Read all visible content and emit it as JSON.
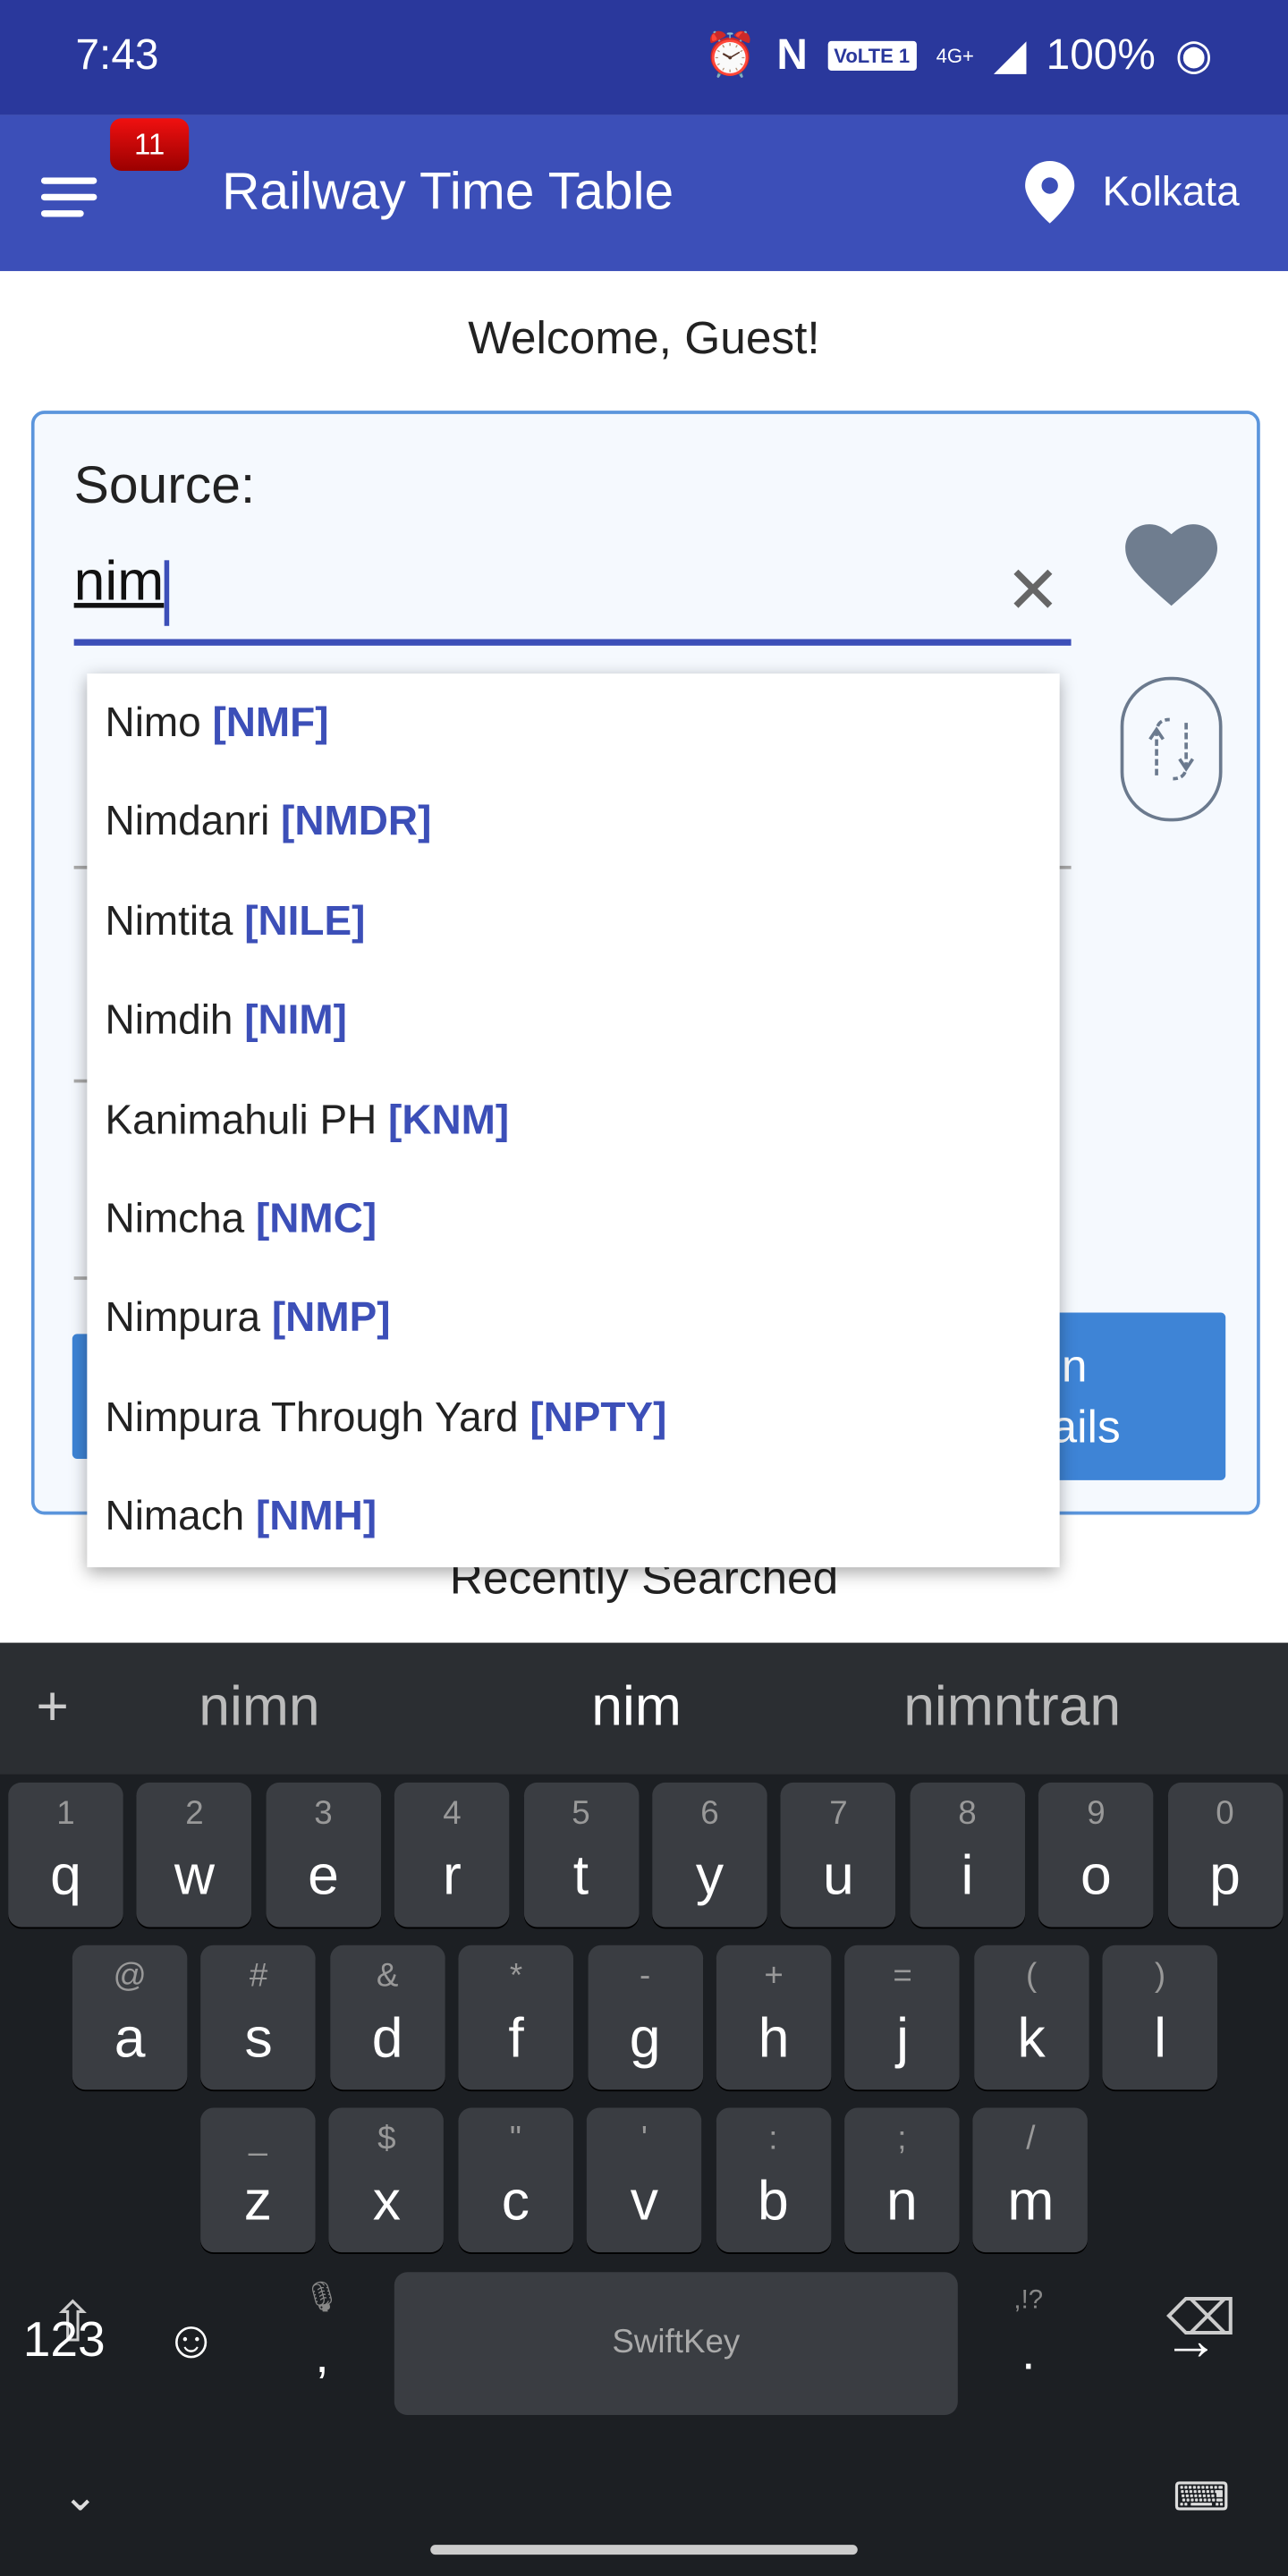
{
  "status_bar": {
    "time": "7:43",
    "volte": "VoLTE 1",
    "network": "4G+",
    "battery": "100%"
  },
  "app_bar": {
    "title": "Railway Time Table",
    "notification_count": "11",
    "location": "Kolkata"
  },
  "welcome": "Welcome, Guest!",
  "form": {
    "source_label": "Source:",
    "source_value": "nim",
    "button_partial": [
      "in",
      "ails"
    ]
  },
  "recently_searched": "Recently Searched",
  "suggestions": [
    {
      "name": "Nimo",
      "code": "[NMF]"
    },
    {
      "name": "Nimdanri",
      "code": "[NMDR]"
    },
    {
      "name": "Nimtita",
      "code": "[NILE]"
    },
    {
      "name": "Nimdih",
      "code": "[NIM]"
    },
    {
      "name": "Kanimahuli PH",
      "code": "[KNM]"
    },
    {
      "name": "Nimcha",
      "code": "[NMC]"
    },
    {
      "name": "Nimpura",
      "code": "[NMP]"
    },
    {
      "name": "Nimpura Through Yard",
      "code": "[NPTY]"
    },
    {
      "name": "Nimach",
      "code": "[NMH]"
    }
  ],
  "keyboard": {
    "predictions": [
      "nimn",
      "nim",
      "nimntran"
    ],
    "row1": [
      [
        "1",
        "q"
      ],
      [
        "2",
        "w"
      ],
      [
        "3",
        "e"
      ],
      [
        "4",
        "r"
      ],
      [
        "5",
        "t"
      ],
      [
        "6",
        "y"
      ],
      [
        "7",
        "u"
      ],
      [
        "8",
        "i"
      ],
      [
        "9",
        "o"
      ],
      [
        "0",
        "p"
      ]
    ],
    "row2": [
      [
        "@",
        "a"
      ],
      [
        "#",
        "s"
      ],
      [
        "&",
        "d"
      ],
      [
        "*",
        "f"
      ],
      [
        "-",
        "g"
      ],
      [
        "+",
        "h"
      ],
      [
        "=",
        "j"
      ],
      [
        "(",
        "k"
      ],
      [
        ")",
        "l"
      ]
    ],
    "row3": [
      [
        "_",
        "z"
      ],
      [
        "$",
        "x"
      ],
      [
        "\"",
        "c"
      ],
      [
        "'",
        "v"
      ],
      [
        ":",
        "b"
      ],
      [
        ";",
        "n"
      ],
      [
        "/",
        "m"
      ]
    ],
    "numbers_key": "123",
    "comma": ",",
    "period": ".",
    "period_hint": ",!?",
    "space_label": "SwiftKey"
  },
  "colors": {
    "primary": "#3c4fb8",
    "status_bar": "#2a389c",
    "accent_button": "#3e84d6",
    "badge": "#e00000"
  }
}
